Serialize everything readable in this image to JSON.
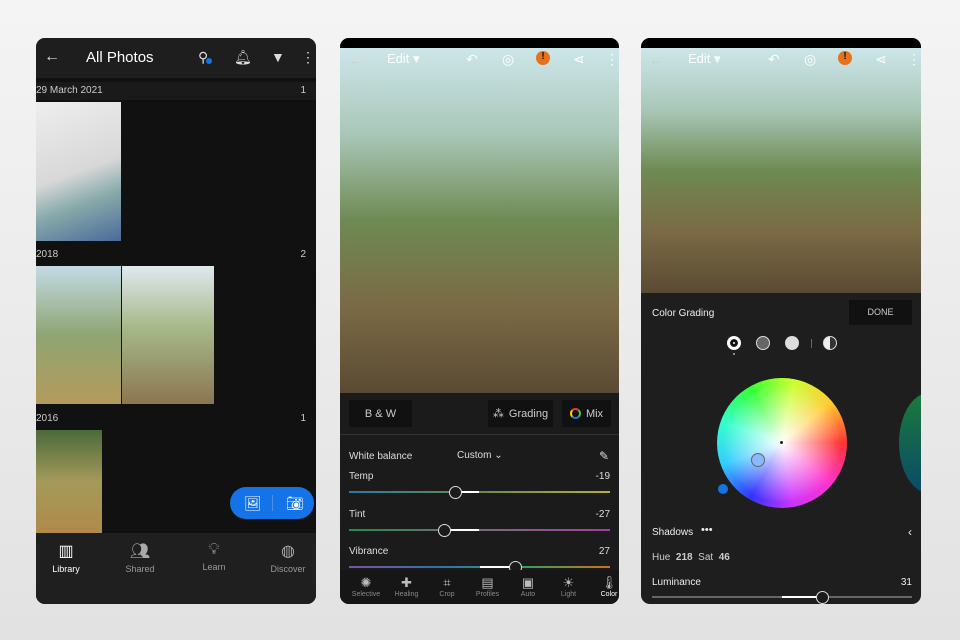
{
  "library": {
    "title": "All Photos",
    "groups": [
      {
        "date": "29 March 2021",
        "count": "1"
      },
      {
        "date": "2018",
        "count": "2"
      },
      {
        "date": "2016",
        "count": "1"
      }
    ],
    "nav": [
      {
        "label": "Library",
        "icon": "library-icon"
      },
      {
        "label": "Shared",
        "icon": "shared-icon"
      },
      {
        "label": "Learn",
        "icon": "learn-icon"
      },
      {
        "label": "Discover",
        "icon": "globe-icon"
      }
    ],
    "accent": "#1473e6"
  },
  "edit": {
    "mode": "Edit",
    "bw": "B & W",
    "grading": "Grading",
    "mix": "Mix",
    "white_balance": {
      "label": "White balance",
      "value": "Custom"
    },
    "sliders": [
      {
        "label": "Temp",
        "value": "-19",
        "level": -19
      },
      {
        "label": "Tint",
        "value": "-27",
        "level": -27
      },
      {
        "label": "Vibrance",
        "value": "27",
        "level": 27
      }
    ],
    "tools": [
      "Selective",
      "Healing",
      "Crop",
      "Profiles",
      "Auto",
      "Light",
      "Color"
    ],
    "warning_color": "#e8711c"
  },
  "grading": {
    "mode": "Edit",
    "title": "Color Grading",
    "done": "DONE",
    "region": "Shadows",
    "hue_label": "Hue",
    "hue": "218",
    "sat_label": "Sat",
    "sat": "46",
    "luminance_label": "Luminance",
    "luminance": "31"
  }
}
